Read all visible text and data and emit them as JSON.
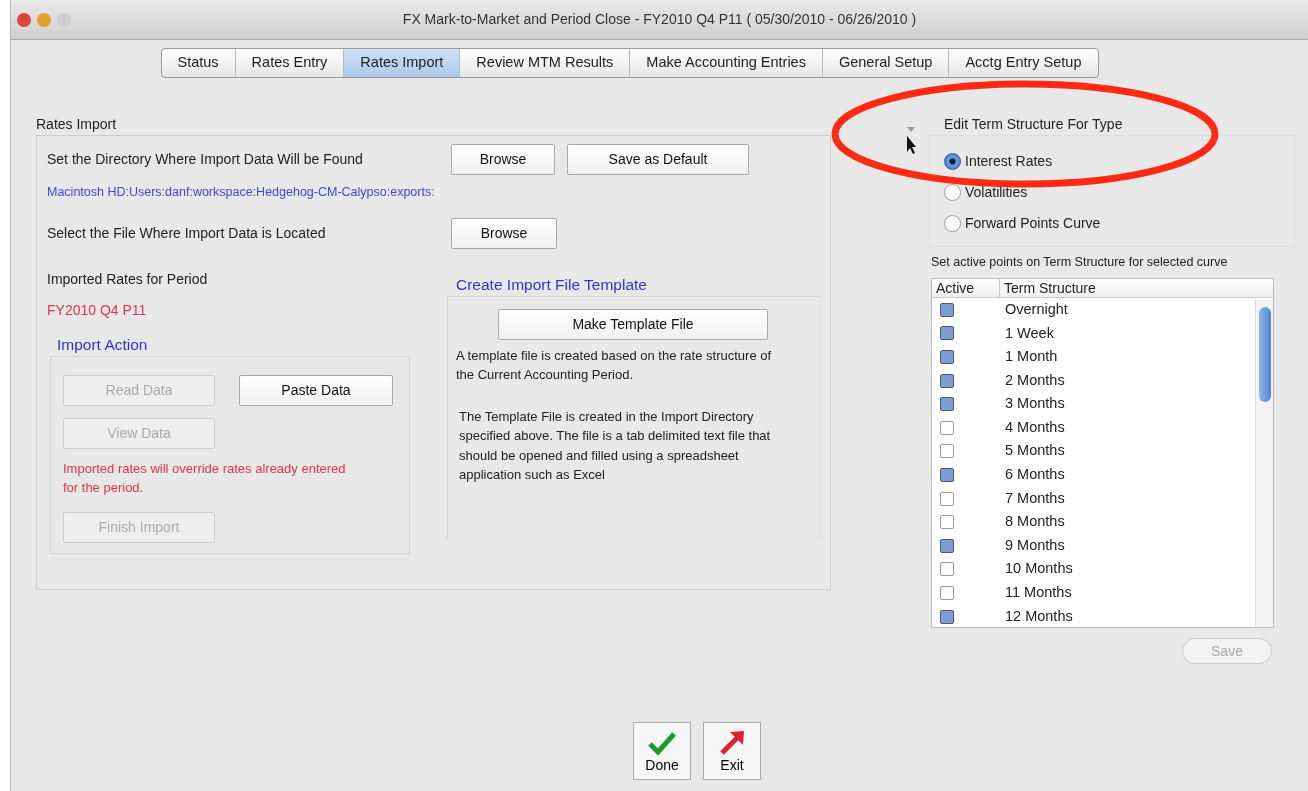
{
  "window": {
    "title": "FX Mark-to-Market and Period Close - FY2010 Q4 P11  ( 05/30/2010 - 06/26/2010 )"
  },
  "tabs": [
    {
      "label": "Status",
      "selected": false
    },
    {
      "label": "Rates Entry",
      "selected": false
    },
    {
      "label": "Rates Import",
      "selected": true
    },
    {
      "label": "Review MTM Results",
      "selected": false
    },
    {
      "label": "Make Accounting Entries",
      "selected": false
    },
    {
      "label": "General Setup",
      "selected": false
    },
    {
      "label": "Acctg Entry Setup",
      "selected": false
    }
  ],
  "rates_import": {
    "title": "Rates Import",
    "directory_label": "Set the Directory Where Import Data Will be Found",
    "browse_directory": {
      "label": "Browse",
      "disabled": false
    },
    "save_default": {
      "label": "Save as Default",
      "disabled": false
    },
    "directory_path": "Macintosh HD:Users:danf:workspace:Hedgehog-CM-Calypso:exports:",
    "file_label": "Select the File Where Import Data is Located",
    "browse_file": {
      "label": "Browse",
      "disabled": false
    },
    "period_label": "Imported Rates for Period",
    "period_value": "FY2010 Q4 P11"
  },
  "import_action": {
    "title": "Import Action",
    "buttons": [
      {
        "label": "Read Data",
        "disabled": true
      },
      {
        "label": "Paste Data",
        "disabled": false
      },
      {
        "label": "View Data",
        "disabled": true
      }
    ],
    "warning": "Imported rates will override rates already entered for the period.",
    "finish": {
      "label": "Finish Import",
      "disabled": true
    }
  },
  "template": {
    "title": "Create Import File Template",
    "button": {
      "label": "Make Template File",
      "disabled": false
    },
    "note_1": "A template file is created based on the rate structure of the Current Accounting Period.",
    "note_2": "The Template File is created in the Import Directory specified above.  The file is a tab delimited text file that should be opened and filled using a spreadsheet application such as Excel"
  },
  "term_structure": {
    "title": "Edit Term Structure For Type",
    "types": [
      {
        "label": "Interest Rates",
        "selected": true
      },
      {
        "label": "Volatilities",
        "selected": false
      },
      {
        "label": "Forward Points Curve",
        "selected": false
      }
    ],
    "instruction": "Set active points on Term Structure for selected curve",
    "columns": [
      "Active",
      "Term Structure"
    ],
    "rows": [
      {
        "term": "Overnight",
        "active": true
      },
      {
        "term": "1 Week",
        "active": true
      },
      {
        "term": "1 Month",
        "active": true
      },
      {
        "term": "2 Months",
        "active": true
      },
      {
        "term": "3 Months",
        "active": true
      },
      {
        "term": "4 Months",
        "active": false
      },
      {
        "term": "5 Months",
        "active": false
      },
      {
        "term": "6 Months",
        "active": true
      },
      {
        "term": "7 Months",
        "active": false
      },
      {
        "term": "8 Months",
        "active": false
      },
      {
        "term": "9 Months",
        "active": true
      },
      {
        "term": "10 Months",
        "active": false
      },
      {
        "term": "11 Months",
        "active": false
      },
      {
        "term": "12 Months",
        "active": true
      }
    ],
    "save": {
      "label": "Save",
      "disabled": true
    }
  },
  "footer_buttons": [
    {
      "kind": "done",
      "label": "Done"
    },
    {
      "kind": "exit",
      "label": "Exit"
    }
  ]
}
